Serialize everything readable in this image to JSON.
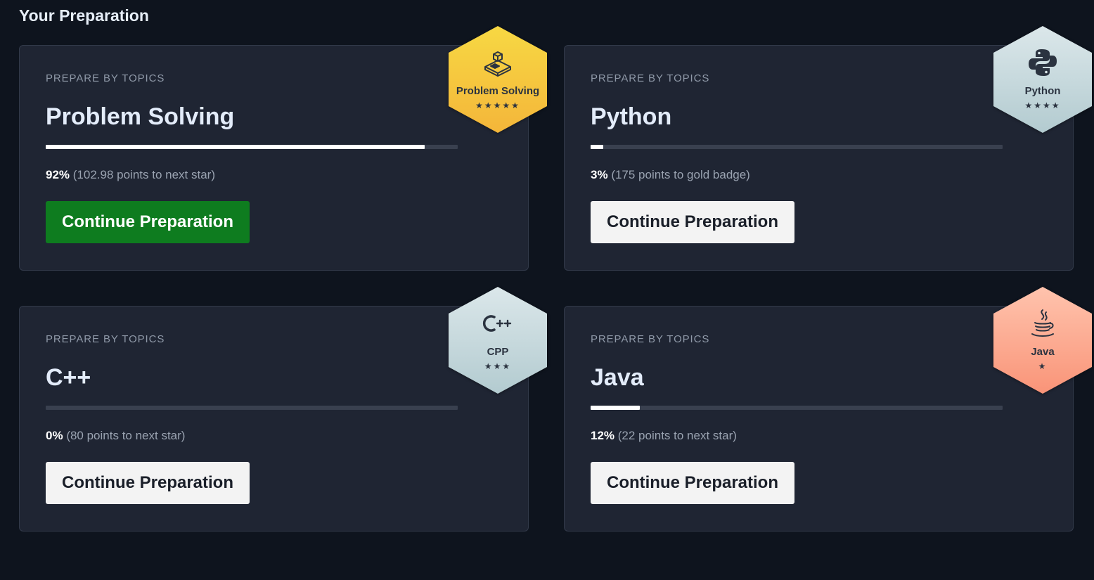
{
  "section": {
    "title": "Your Preparation"
  },
  "cards": [
    {
      "eyebrow": "PREPARE BY TOPICS",
      "topic": "Problem Solving",
      "progress_percent": 92,
      "percent_text": "92%",
      "progress_note": "(102.98 points to next star)",
      "button_label": "Continue Preparation",
      "button_style": "primary",
      "badge": {
        "label": "Problem Solving",
        "stars_text": "★★★★★",
        "stars": 5,
        "icon": "cube-blocks-icon",
        "color_top": "#f7d843",
        "color_bottom": "#f4b63a"
      }
    },
    {
      "eyebrow": "PREPARE BY TOPICS",
      "topic": "Python",
      "progress_percent": 3,
      "percent_text": "3%",
      "progress_note": "(175 points to gold badge)",
      "button_label": "Continue Preparation",
      "button_style": "secondary",
      "badge": {
        "label": "Python",
        "stars_text": "★★★★",
        "stars": 4,
        "icon": "python-logo-icon",
        "color_top": "#dbe7ea",
        "color_bottom": "#b3cbd0"
      }
    },
    {
      "eyebrow": "PREPARE BY TOPICS",
      "topic": "C++",
      "progress_percent": 0,
      "percent_text": "0%",
      "progress_note": "(80 points to next star)",
      "button_label": "Continue Preparation",
      "button_style": "secondary",
      "badge": {
        "label": "CPP",
        "stars_text": "★★★",
        "stars": 3,
        "icon": "cpp-logo-icon",
        "color_top": "#dbe7ea",
        "color_bottom": "#b3cbd0"
      }
    },
    {
      "eyebrow": "PREPARE BY TOPICS",
      "topic": "Java",
      "progress_percent": 12,
      "percent_text": "12%",
      "progress_note": "(22 points to next star)",
      "button_label": "Continue Preparation",
      "button_style": "secondary",
      "badge": {
        "label": "Java",
        "stars_text": "★",
        "stars": 1,
        "icon": "java-cup-icon",
        "color_top": "#ffc3ad",
        "color_bottom": "#f99478"
      }
    }
  ]
}
